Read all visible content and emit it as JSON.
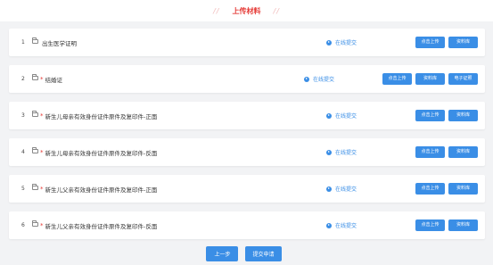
{
  "header": {
    "title": "上传材料",
    "deco_left": "// ",
    "deco_right": "//"
  },
  "online_label": "在线提交",
  "items": [
    {
      "index": "1",
      "required": "",
      "label": "出生医学证明",
      "buttons": [
        "点击上传",
        "资料库"
      ]
    },
    {
      "index": "2",
      "required": "*",
      "label": "结婚证",
      "buttons": [
        "点击上传",
        "资料库",
        "电子证照"
      ]
    },
    {
      "index": "3",
      "required": "*",
      "label": "新生儿母亲有效身份证件原件及复印件-正面",
      "buttons": [
        "点击上传",
        "资料库"
      ]
    },
    {
      "index": "4",
      "required": "*",
      "label": "新生儿母亲有效身份证件原件及复印件-反面",
      "buttons": [
        "点击上传",
        "资料库"
      ]
    },
    {
      "index": "5",
      "required": "*",
      "label": "新生儿父亲有效身份证件原件及复印件-正面",
      "buttons": [
        "点击上传",
        "资料库"
      ]
    },
    {
      "index": "6",
      "required": "*",
      "label": "新生儿父亲有效身份证件原件及复印件-反面",
      "buttons": [
        "点击上传",
        "资料库"
      ]
    }
  ],
  "footer": {
    "prev_label": "上一步",
    "submit_label": "提交申请"
  },
  "colors": {
    "primary": "#3a8ee6",
    "title_red": "#e53935",
    "required_red": "#e53935"
  }
}
